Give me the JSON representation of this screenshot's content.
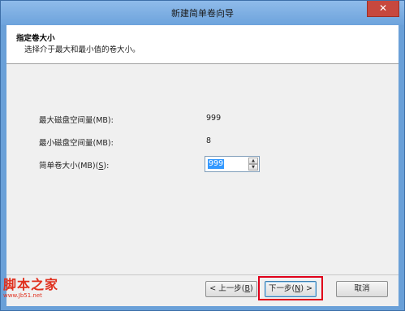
{
  "window": {
    "title": "新建简单卷向导",
    "close_glyph": "✕"
  },
  "header": {
    "title": "指定卷大小",
    "description": "选择介于最大和最小值的卷大小。"
  },
  "fields": {
    "max_label": "最大磁盘空间量(MB):",
    "max_value": "999",
    "min_label": "最小磁盘空间量(MB):",
    "min_value": "8",
    "size_label_prefix": "简单卷大小(MB)(",
    "size_label_key": "S",
    "size_label_suffix": "):",
    "size_value": "999"
  },
  "buttons": {
    "back_prefix": "< 上一步(",
    "back_key": "B",
    "back_suffix": ")",
    "next_prefix": "下一步(",
    "next_key": "N",
    "next_suffix": ") >",
    "cancel": "取消"
  },
  "watermark": {
    "main": "脚本之家",
    "sub": "www.Jb51.net"
  },
  "colors": {
    "highlight": "#e0001a",
    "titlebar": "#6da3dc",
    "selection": "#3399ff"
  }
}
